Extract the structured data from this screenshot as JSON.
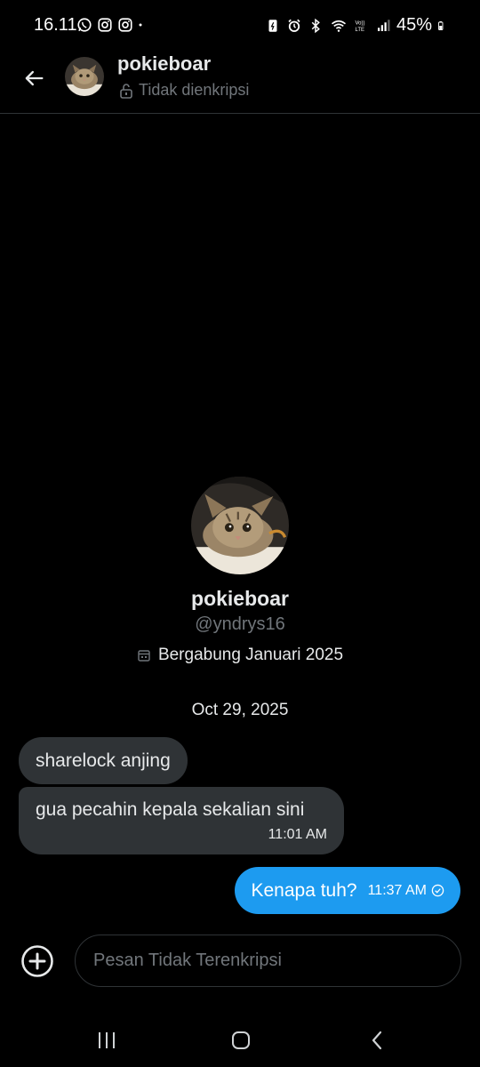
{
  "status_bar": {
    "time": "16.11",
    "battery": "45%",
    "left_icons": [
      "whatsapp-icon",
      "instagram-icon",
      "instagram-icon",
      "dot-icon"
    ],
    "right_icons": [
      "battery-saver-icon",
      "alarm-icon",
      "bluetooth-icon",
      "wifi-icon",
      "volte-icon",
      "signal-icon",
      "battery-icon"
    ]
  },
  "header": {
    "name": "pokieboar",
    "encryption_status": "Tidak dienkripsi"
  },
  "profile": {
    "name": "pokieboar",
    "handle": "@yndrys16",
    "joined": "Bergabung Januari 2025"
  },
  "date_separator": "Oct 29, 2025",
  "messages": [
    {
      "direction": "in",
      "text": "sharelock anjing"
    },
    {
      "direction": "in",
      "text": "gua pecahin kepala sekalian sini",
      "time": "11:01 AM"
    },
    {
      "direction": "out",
      "text": "Kenapa tuh?",
      "time": "11:37 AM",
      "status": "sent"
    }
  ],
  "composer": {
    "placeholder": "Pesan Tidak Terenkripsi"
  },
  "colors": {
    "background": "#000000",
    "bubble_in": "#2f3336",
    "bubble_out": "#1d9bf0",
    "muted_text": "#71767b"
  }
}
